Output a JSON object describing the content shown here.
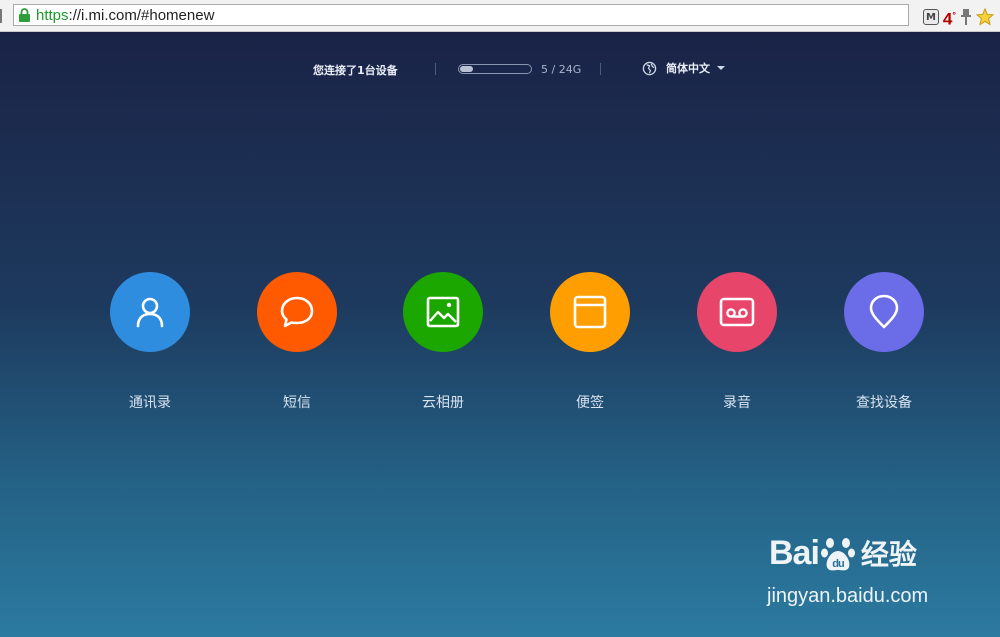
{
  "browser": {
    "url_scheme": "https",
    "url_rest": "://i.mi.com/#homenew",
    "ext_temperature": "4",
    "ext_temperature_unit": "°"
  },
  "topbar": {
    "device_status": "您连接了1台设备",
    "storage": {
      "used_gb": 5,
      "total_gb": 24,
      "label": "5 / 24G",
      "fill_fraction": 0.208
    },
    "language": "简体中文"
  },
  "apps": [
    {
      "label": "通讯录",
      "icon": "contacts-person-icon",
      "color": "#2f8de0"
    },
    {
      "label": "短信",
      "icon": "message-bubble-icon",
      "color": "#ff5a00"
    },
    {
      "label": "云相册",
      "icon": "photo-gallery-icon",
      "color": "#1ca600"
    },
    {
      "label": "便签",
      "icon": "note-window-icon",
      "color": "#ff9e00"
    },
    {
      "label": "录音",
      "icon": "voicemail-recorder-icon",
      "color": "#e8456a"
    },
    {
      "label": "查找设备",
      "icon": "location-pin-icon",
      "color": "#6b6ce8"
    }
  ],
  "watermark": {
    "brand_a": "Bai",
    "brand_b": "du",
    "brand_cn": "经验",
    "domain": "jingyan.baidu.com"
  }
}
